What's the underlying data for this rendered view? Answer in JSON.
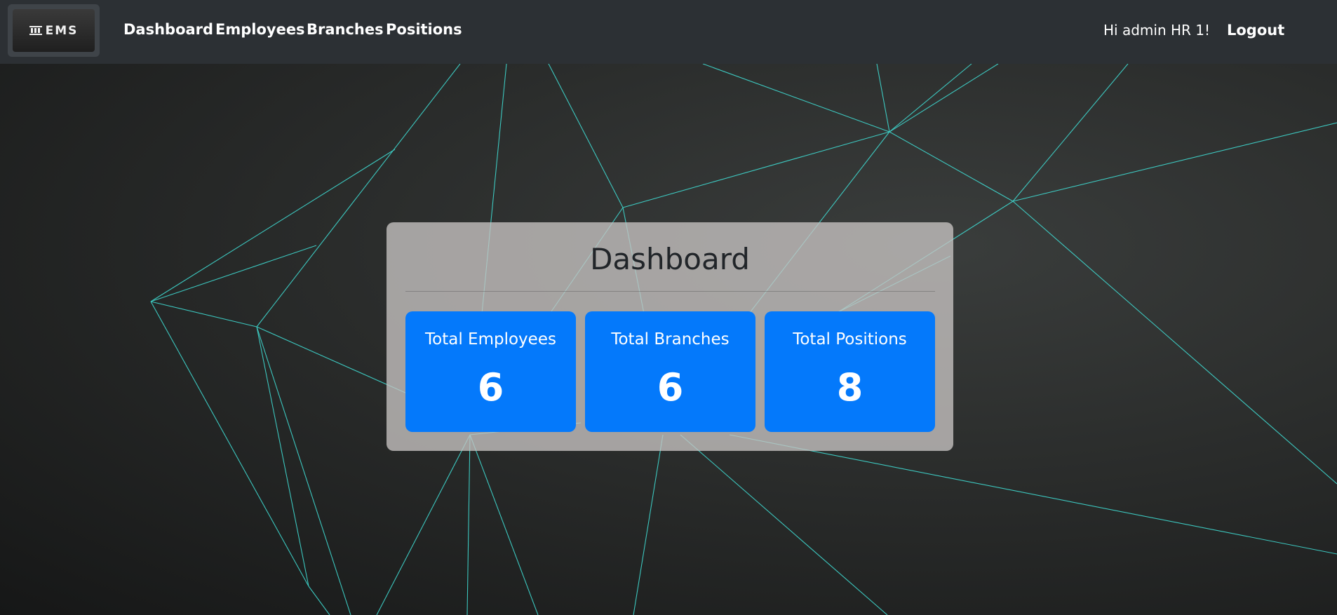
{
  "app": {
    "logo_text": "EMS"
  },
  "nav": {
    "links": [
      "Dashboard",
      "Employees",
      "Branches",
      "Positions"
    ],
    "greeting": "Hi admin HR 1!",
    "logout_label": "Logout"
  },
  "dashboard": {
    "title": "Dashboard",
    "cards": [
      {
        "label": "Total Employees",
        "value": "6"
      },
      {
        "label": "Total Branches",
        "value": "6"
      },
      {
        "label": "Total Positions",
        "value": "8"
      }
    ]
  },
  "colors": {
    "navbar": "#2c3034",
    "card": "#0479fb",
    "panel": "#c8c4c3",
    "lines": "#3fd9d0"
  }
}
